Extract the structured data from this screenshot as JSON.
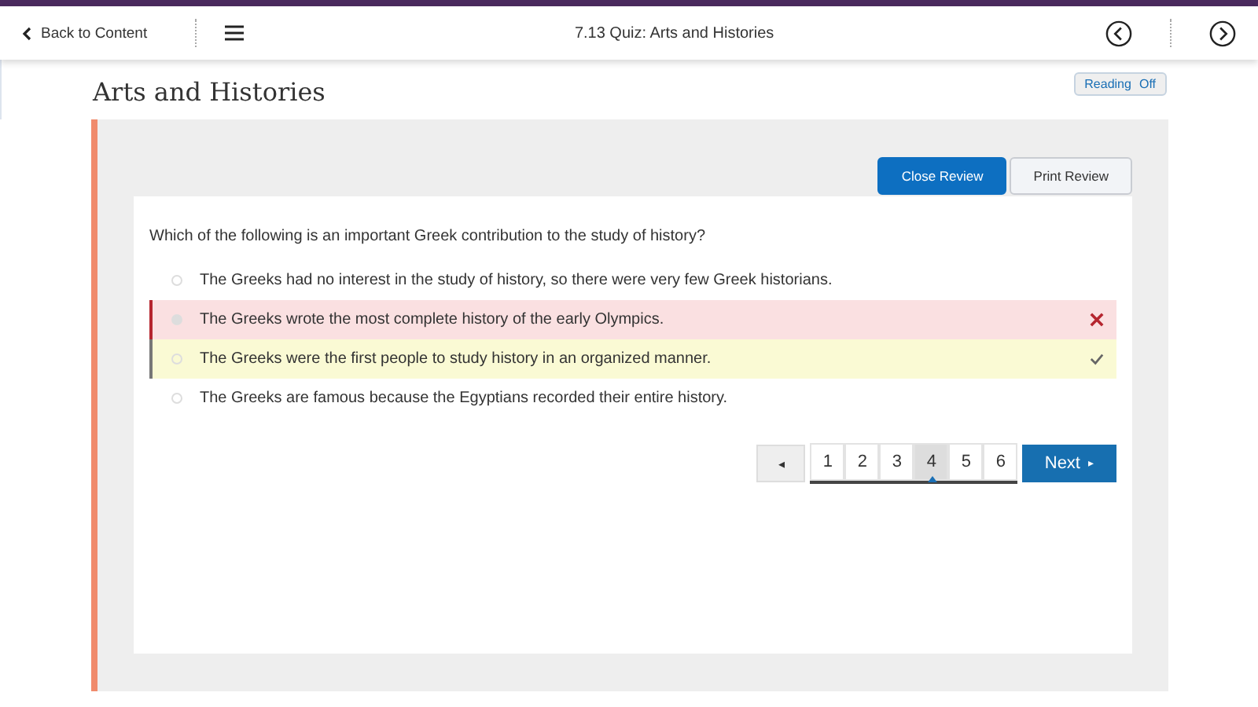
{
  "header": {
    "back": "Back to Content",
    "title": "7.13 Quiz: Arts and Histories"
  },
  "page_title": "Arts and Histories",
  "reading": {
    "label": "Reading",
    "state": "Off"
  },
  "review_buttons": [
    {
      "label": "Close Review",
      "kind": "primary"
    },
    {
      "label": "Print Review",
      "kind": "secondary"
    }
  ],
  "question": "Which of the following is an important Greek contribution to the study of history?",
  "answers": [
    {
      "text": "The Greeks had no interest in the study of history, so there were very few Greek historians.",
      "selected": false,
      "kind": "none"
    },
    {
      "text": "The Greeks wrote the most complete history of the early Olympics.",
      "selected": true,
      "kind": "incorrect"
    },
    {
      "text": "The Greeks were the first people to study history in an organized manner.",
      "selected": false,
      "kind": "correct"
    },
    {
      "text": "The Greeks are famous because the Egyptians recorded their entire history.",
      "selected": false,
      "kind": "none"
    }
  ],
  "pager": {
    "prev": "◂",
    "pages": [
      {
        "label": "1",
        "selected": false
      },
      {
        "label": "2",
        "selected": false
      },
      {
        "label": "3",
        "selected": false
      },
      {
        "label": "4",
        "selected": true
      },
      {
        "label": "5",
        "selected": false
      },
      {
        "label": "6",
        "selected": false
      }
    ],
    "next": "Next",
    "next_arrow": "▸"
  }
}
